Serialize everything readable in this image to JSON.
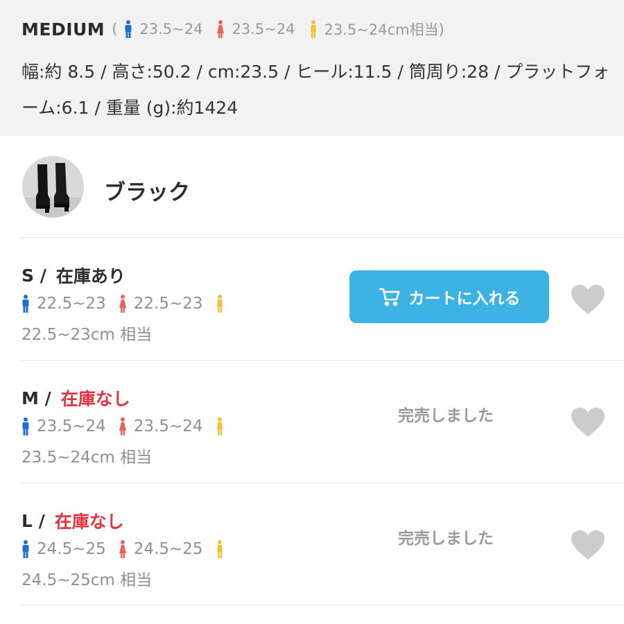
{
  "header": {
    "size_name": "MEDIUM",
    "open_paren": "(",
    "range_men": "23.5~24",
    "range_women": "23.5~24",
    "range_unisex": "23.5~24cm相当)",
    "spec_line": "幅:約 8.5 / 高さ:50.2 / cm:23.5 / ヒール:11.5 / 筒周り:28 / プラットフォーム:6.1 / 重量 (g):約1424"
  },
  "color": {
    "name": "ブラック",
    "thumbnail": "black-knee-high-platform-boots"
  },
  "sizes": [
    {
      "size": "S",
      "slash": "/",
      "stock": "在庫あり",
      "in_stock": true,
      "men": "22.5~23",
      "women": "22.5~23",
      "cm": "22.5~23cm 相当",
      "action": "カートに入れる"
    },
    {
      "size": "M",
      "slash": "/",
      "stock": "在庫なし",
      "in_stock": false,
      "men": "23.5~24",
      "women": "23.5~24",
      "cm": "23.5~24cm 相当",
      "action": "完売しました"
    },
    {
      "size": "L",
      "slash": "/",
      "stock": "在庫なし",
      "in_stock": false,
      "men": "24.5~25",
      "women": "24.5~25",
      "cm": "24.5~25cm 相当",
      "action": "完売しました"
    }
  ],
  "icons": {
    "men": "male-figure-icon",
    "women": "female-figure-icon",
    "unisex": "unisex-figure-icon",
    "cart": "cart-icon",
    "favorite": "heart-icon"
  },
  "colors": {
    "accent_button": "#3db3e5",
    "out_of_stock": "#e0343e",
    "men_icon": "#1e6fd0",
    "women_icon": "#e8635a",
    "unisex_icon": "#f0c23a",
    "heart": "#cccccc",
    "panel_bg": "#f2f2f2"
  }
}
